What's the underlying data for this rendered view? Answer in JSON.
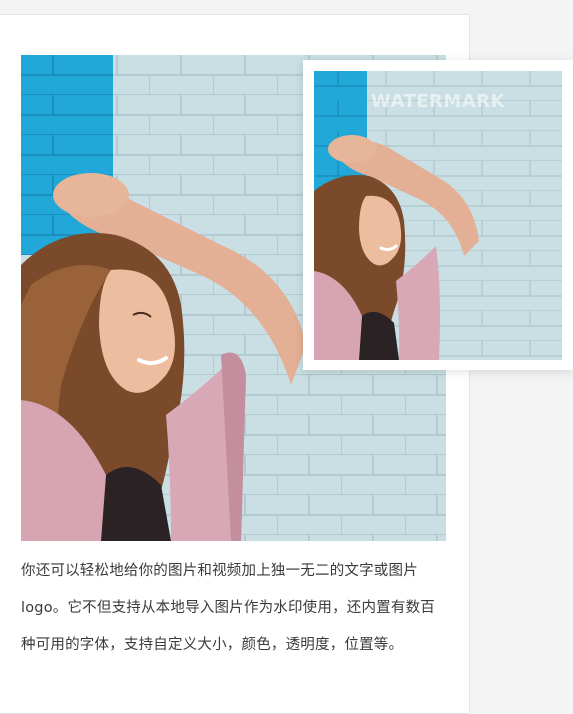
{
  "photo": {
    "alt": "A woman with curly auburn hair in a pink cardigan smiling and leaning against a light blue painted brick wall"
  },
  "watermark_preview": {
    "watermark_text": "WATERMARK"
  },
  "description": {
    "text": "你还可以轻松地给你的图片和视频加上独一无二的文字或图片logo。它不但支持从本地导入图片作为水印使用，还内置有数百种可用的字体，支持自定义大小，颜色，透明度，位置等。"
  },
  "colors": {
    "wall_light": "#c7dde1",
    "wall_accent": "#1fa6d6",
    "cardigan": "#d9a8b6",
    "hair": "#7a4a2a",
    "skin": "#e7b59a"
  }
}
